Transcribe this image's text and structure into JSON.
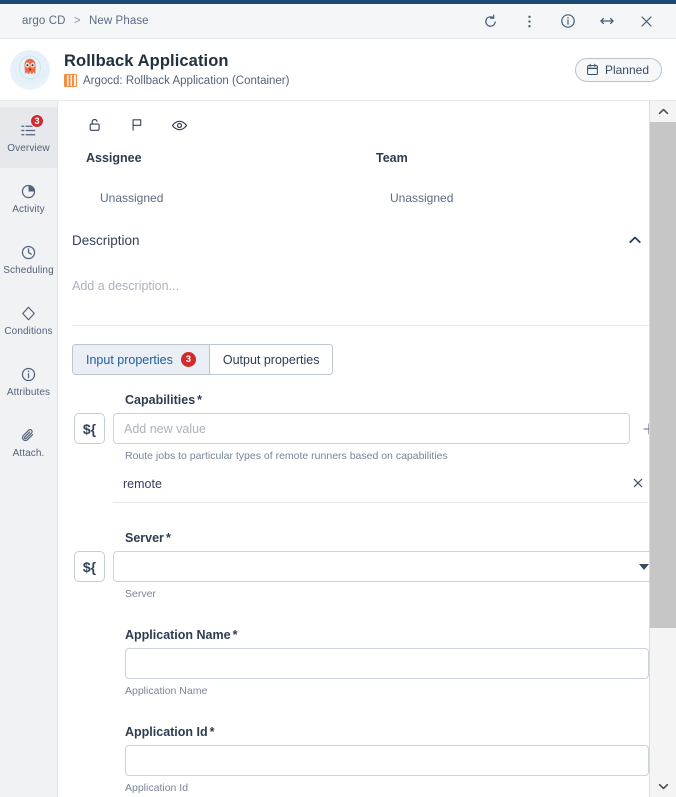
{
  "window": {
    "breadcrumb": {
      "root": "argo CD",
      "separator": ">",
      "current": "New Phase"
    },
    "controls": [
      {
        "name": "refresh-button",
        "icon": "refresh-icon"
      },
      {
        "name": "more-menu-button",
        "icon": "vertical-dots-icon"
      },
      {
        "name": "info-button",
        "icon": "info-circle-icon"
      },
      {
        "name": "resize-button",
        "icon": "horizontal-arrows-icon"
      },
      {
        "name": "close-button",
        "icon": "close-x-icon"
      }
    ]
  },
  "header": {
    "title": "Rollback Application",
    "subtitle": "Argocd: Rollback Application (Container)",
    "avatar_icon": "argo-octopus-logo",
    "subtitle_icon": "container-bars-icon",
    "status": {
      "label": "Planned",
      "icon": "calendar-icon"
    }
  },
  "sidebar": {
    "items": [
      {
        "label": "Overview",
        "icon": "list-icon",
        "badge": "3",
        "active": true
      },
      {
        "label": "Activity",
        "icon": "pie-chart-icon",
        "badge": null,
        "active": false
      },
      {
        "label": "Scheduling",
        "icon": "clock-icon",
        "badge": null,
        "active": false
      },
      {
        "label": "Conditions",
        "icon": "diamond-icon",
        "badge": null,
        "active": false
      },
      {
        "label": "Attributes",
        "icon": "info-circle-icon",
        "badge": null,
        "active": false
      },
      {
        "label": "Attach.",
        "icon": "paperclip-icon",
        "badge": null,
        "active": false
      }
    ]
  },
  "toolbar": {
    "icons": [
      {
        "name": "unlock-icon"
      },
      {
        "name": "flag-icon"
      },
      {
        "name": "eye-icon"
      }
    ]
  },
  "meta": {
    "assignee_label": "Assignee",
    "assignee_value": "Unassigned",
    "team_label": "Team",
    "team_value": "Unassigned"
  },
  "description": {
    "title": "Description",
    "placeholder": "Add a description...",
    "collapse_icon": "chevron-up-icon"
  },
  "tabs": [
    {
      "label": "Input properties",
      "badge": "3",
      "active": true
    },
    {
      "label": "Output properties",
      "badge": null,
      "active": false
    }
  ],
  "form": {
    "fields": [
      {
        "label": "Capabilities",
        "required": "*",
        "variable_button": "${",
        "placeholder": "Add new value",
        "value": "",
        "help": "Route jobs to particular types of remote runners based on capabilities",
        "add_icon": "plus-icon",
        "chips": [
          {
            "text": "remote",
            "remove_icon": "close-x-icon"
          }
        ]
      },
      {
        "label": "Server",
        "required": "*",
        "variable_button": "${",
        "value": "",
        "help": "Server",
        "dropdown_icon": "chevron-down-icon"
      },
      {
        "label": "Application Name",
        "required": "*",
        "value": "",
        "help": "Application Name"
      },
      {
        "label": "Application Id",
        "required": "*",
        "value": "",
        "help": "Application Id"
      }
    ]
  },
  "scrollbar": {
    "up_icon": "chevron-up-icon",
    "down_icon": "chevron-down-icon"
  },
  "colors": {
    "accent_blue": "#1a4971",
    "badge_red": "#d32b2b",
    "tab_active_text": "#215d9c",
    "orange": "#f29145"
  }
}
